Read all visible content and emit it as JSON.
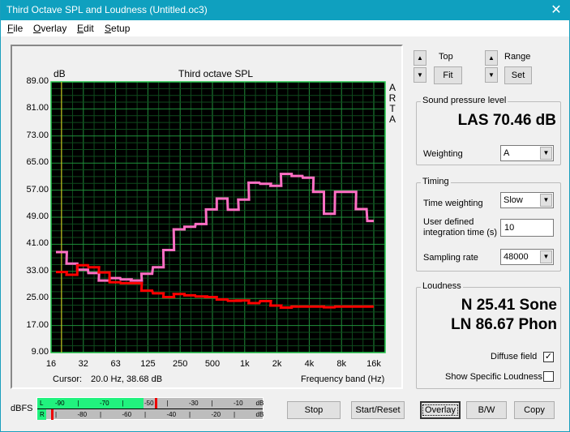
{
  "window": {
    "title": "Third Octave SPL and Loudness (Untitled.oc3)",
    "close_icon": "close-icon"
  },
  "menu": {
    "items": [
      {
        "label": "File",
        "accel": "F",
        "rest": "ile"
      },
      {
        "label": "Overlay",
        "accel": "O",
        "rest": "verlay"
      },
      {
        "label": "Edit",
        "accel": "E",
        "rest": "dit"
      },
      {
        "label": "Setup",
        "accel": "S",
        "rest": "etup"
      }
    ]
  },
  "chart": {
    "ylabel_unit": "dB",
    "title": "Third octave SPL",
    "vertical_brand": [
      "A",
      "R",
      "T",
      "A"
    ],
    "cursor_label": "Cursor:",
    "cursor_value": "20.0 Hz, 38.68 dB",
    "xlabel": "Frequency band (Hz)",
    "colors": {
      "background": "#000000",
      "major_grid": "#1f8f3a",
      "minor_grid": "#0f4a1d",
      "border": "#22c34a",
      "cursor": "#e6d21e",
      "current": "#ff0000",
      "overlay": "#ff6fc4"
    }
  },
  "chart_data": {
    "type": "line",
    "title": "Third octave SPL",
    "xlabel": "Frequency band (Hz)",
    "ylabel": "dB",
    "ylim": [
      9,
      89
    ],
    "yticks": [
      "89.00",
      "81.00",
      "73.00",
      "65.00",
      "57.00",
      "49.00",
      "41.00",
      "33.00",
      "25.00",
      "17.00",
      "9.00"
    ],
    "xtick_labels": [
      "16",
      "32",
      "63",
      "125",
      "250",
      "500",
      "1k",
      "2k",
      "4k",
      "8k",
      "16k"
    ],
    "x_scale": "log2 third-octave bands",
    "grid": true,
    "step": true,
    "cursor_hz": 20.0,
    "bands_hz": [
      16,
      20,
      25,
      31.5,
      40,
      50,
      63,
      80,
      100,
      125,
      160,
      200,
      250,
      315,
      400,
      500,
      630,
      800,
      1000,
      1250,
      1600,
      2000,
      2500,
      3150,
      4000,
      5000,
      6300,
      8000,
      10000,
      12500,
      16000
    ],
    "series": [
      {
        "name": "Overlay",
        "color": "#ff6fc4",
        "values": [
          38.7,
          38.7,
          35.3,
          33.5,
          32.5,
          30.3,
          31.0,
          30.6,
          30.3,
          32.3,
          34.2,
          39.3,
          45.4,
          46.2,
          47.0,
          51.3,
          54.5,
          51.2,
          54.2,
          59.2,
          58.9,
          58.3,
          61.8,
          61.2,
          60.7,
          56.5,
          50.0,
          56.5,
          56.5,
          51.4,
          47.9
        ]
      },
      {
        "name": "Current",
        "color": "#ff0000",
        "values": [
          32.8,
          32.8,
          32.0,
          34.8,
          34.2,
          32.7,
          29.8,
          29.5,
          29.5,
          27.3,
          26.5,
          25.4,
          26.3,
          25.9,
          25.6,
          25.4,
          24.7,
          24.3,
          24.4,
          23.6,
          24.2,
          22.9,
          22.3,
          22.6,
          22.6,
          22.6,
          22.4,
          22.6,
          22.6,
          22.6,
          22.6
        ]
      }
    ]
  },
  "controls": {
    "top_label": "Top",
    "fit_label": "Fit",
    "range_label": "Range",
    "set_label": "Set",
    "spin_up": "▲",
    "spin_down": "▼"
  },
  "spl": {
    "group_title": "Sound pressure level",
    "value": "LAS 70.46 dB",
    "weighting_label": "Weighting",
    "weighting_value": "A"
  },
  "timing": {
    "group_title": "Timing",
    "time_weighting_label": "Time weighting",
    "time_weighting_value": "Slow",
    "integration_label_1": "User defined",
    "integration_label_2": "integration time (s)",
    "integration_value": "10",
    "sampling_label": "Sampling rate",
    "sampling_value": "48000"
  },
  "loudness": {
    "group_title": "Loudness",
    "sone": "N 25.41 Sone",
    "phon": "LN 86.67 Phon",
    "diffuse_label": "Diffuse field",
    "diffuse_checked": true,
    "specific_label": "Show Specific Loudness",
    "specific_checked": false
  },
  "meter": {
    "label": "dBFS",
    "left_channel": "L",
    "right_channel": "R",
    "left_ticks": [
      "-90",
      "|",
      "-70",
      "|",
      "-50",
      "|",
      "-30",
      "|",
      "-10",
      "dB"
    ],
    "right_ticks": [
      "|",
      "-80",
      "|",
      "-60",
      "|",
      "-40",
      "|",
      "-20",
      "|",
      "dB"
    ],
    "left_level_dbfs": -53,
    "left_peak_dbfs": -48,
    "right_level_dbfs": -96,
    "right_peak_dbfs": -94,
    "range_dbfs": [
      -100,
      0
    ]
  },
  "buttons": {
    "stop": "Stop",
    "start_reset": "Start/Reset",
    "overlay": "Overlay",
    "bw": "B/W",
    "copy": "Copy"
  }
}
